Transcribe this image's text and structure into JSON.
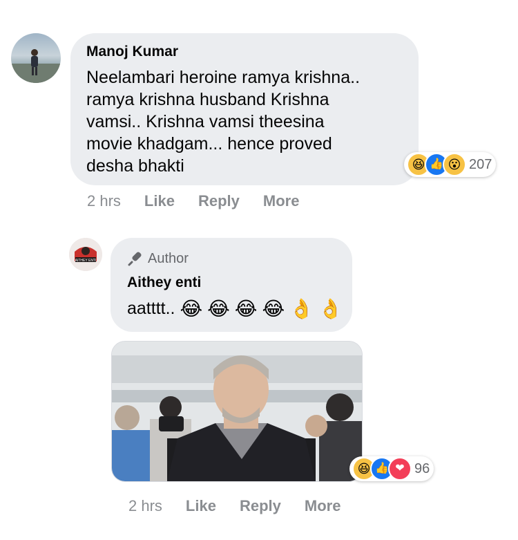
{
  "comment": {
    "author": "Manoj Kumar",
    "text_lines": [
      "Neelambari heroine ramya krishna..",
      "ramya krishna husband Krishna",
      "vamsi.. Krishna vamsi theesina",
      "movie khadgam... hence proved",
      "desha bhakti"
    ],
    "reaction_icons": [
      "haha",
      "like",
      "wow"
    ],
    "reaction_count": "207",
    "time": "2 hrs",
    "actions": {
      "like": "Like",
      "reply": "Reply",
      "more": "More"
    }
  },
  "reply": {
    "badge": "Author",
    "author": "Aithey enti",
    "avatar_text": "AITHEY ENTI",
    "text": "aatttt..",
    "emoji_icons": [
      "joy",
      "joy",
      "joy",
      "joy",
      "ok-hand",
      "ok-hand"
    ],
    "reaction_icons": [
      "haha",
      "like",
      "love"
    ],
    "reaction_count": "96",
    "time": "2 hrs",
    "actions": {
      "like": "Like",
      "reply": "Reply",
      "more": "More"
    }
  },
  "colors": {
    "bubble": "#ebedf0",
    "meta": "#8a8d91",
    "like": "#1877f2",
    "love": "#f33e58",
    "haha": "#f7c244"
  }
}
